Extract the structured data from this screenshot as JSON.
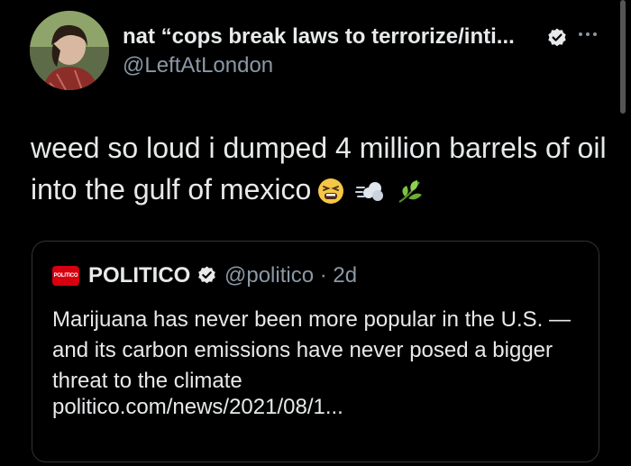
{
  "author": {
    "display_name": "nat “cops break laws to terrorize/inti...",
    "handle": "@LeftAtLondon",
    "verified_icon": "verified-badge-icon",
    "more_icon": "more-options-icon"
  },
  "tweet": {
    "text": "weed so loud i dumped 4 million barrels of oil into the gulf of mexico",
    "emojis": [
      "tired-face-emoji",
      "dash-emoji",
      "herb-emoji"
    ]
  },
  "quote": {
    "logo_text": "POLITICO",
    "name": "POLITICO",
    "handle_time": "@politico · 2d",
    "text": "Marijuana has never been more popular in the U.S. — and its carbon emissions have never posed a bigger threat to the climate",
    "link": "politico.com/news/2021/08/1..."
  },
  "colors": {
    "background": "#000000",
    "text_primary": "#e7e9ea",
    "text_secondary": "#8b98a5",
    "border": "#2f3336",
    "politico_red": "#d6000f"
  }
}
